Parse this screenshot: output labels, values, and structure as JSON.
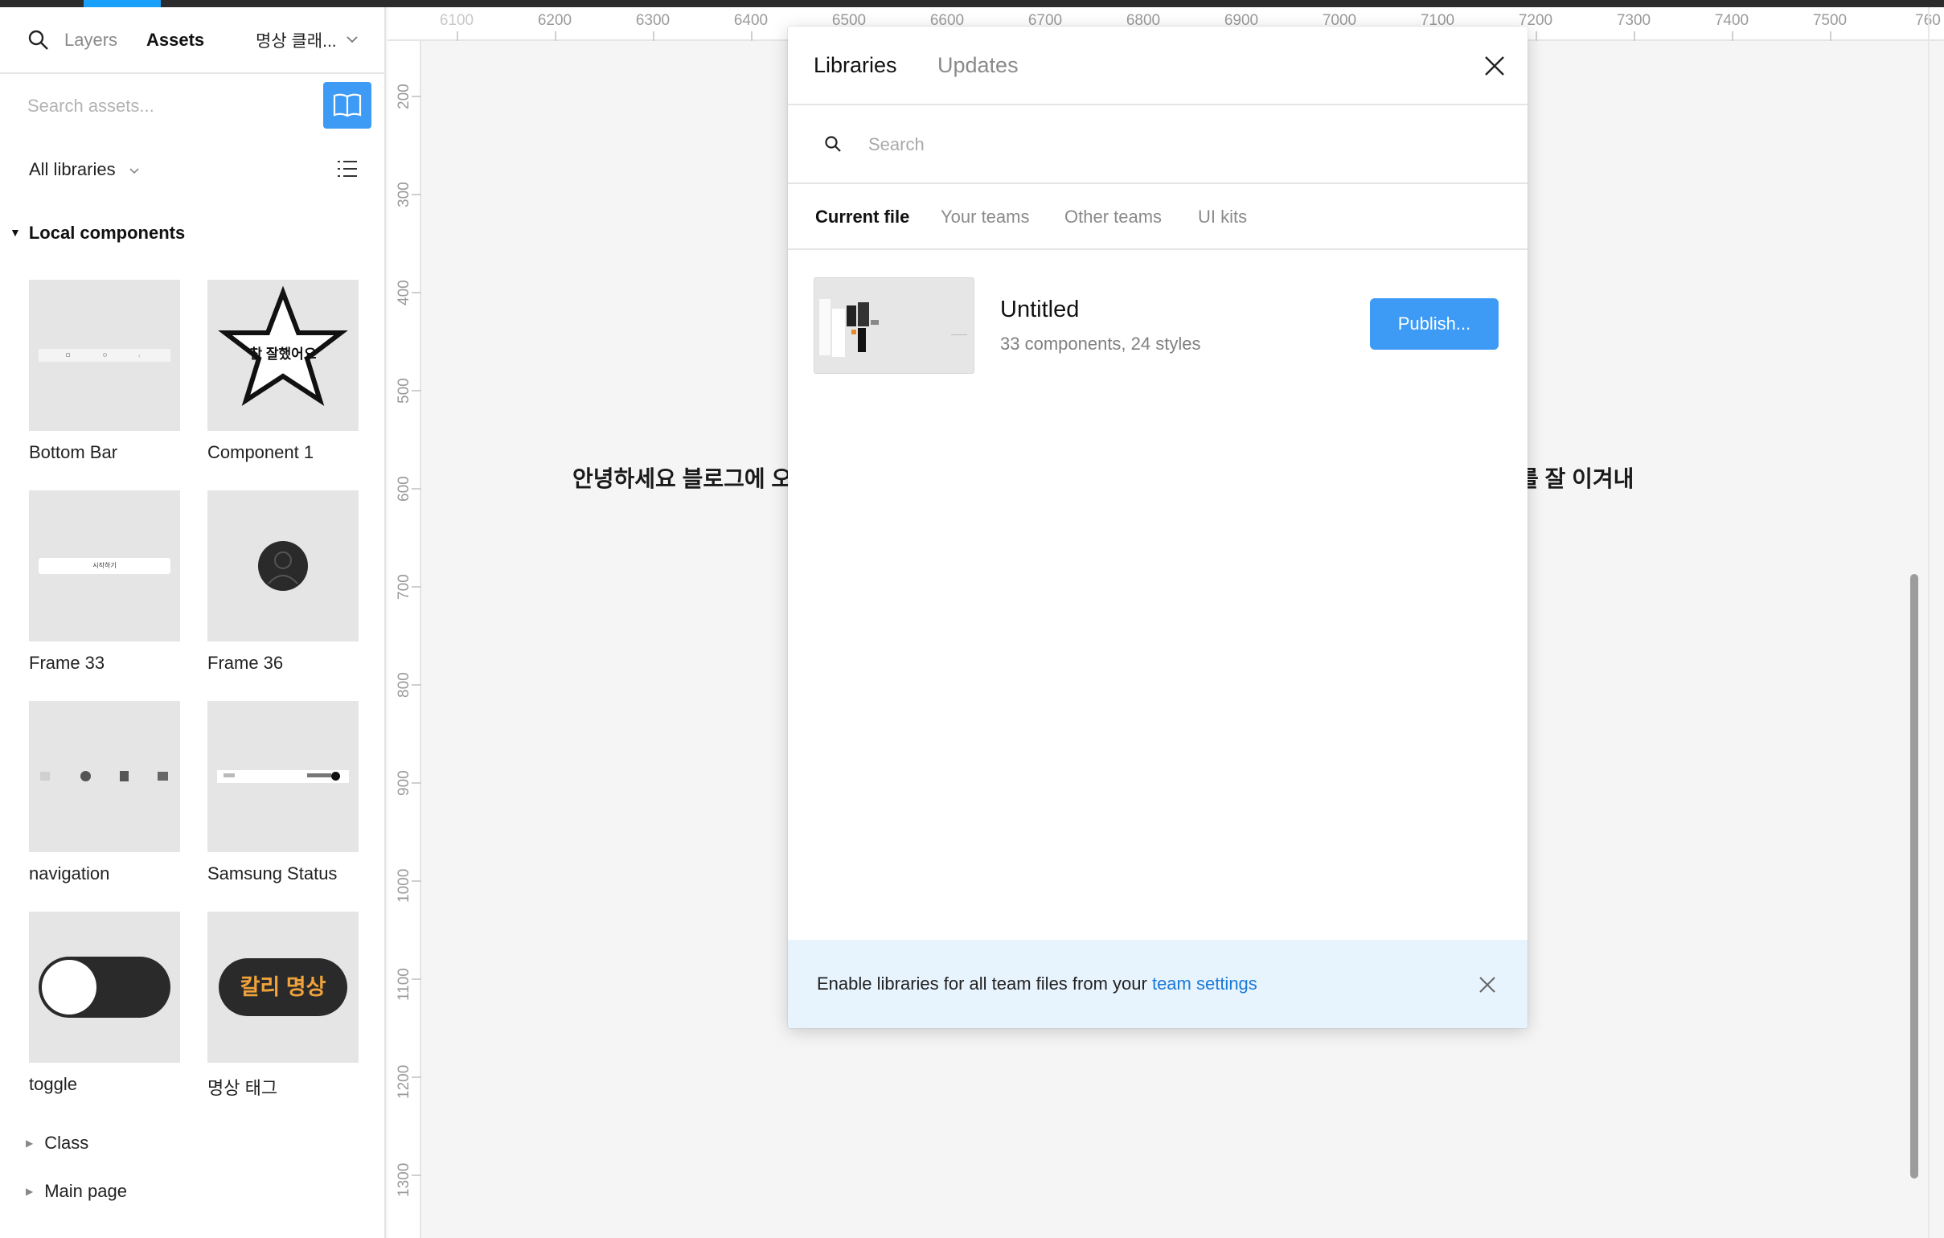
{
  "left_panel": {
    "tabs": {
      "layers": "Layers",
      "assets": "Assets"
    },
    "file_name": "명상 클래...",
    "search_placeholder": "Search assets...",
    "filter_label": "All libraries",
    "section_title": "Local components",
    "components": [
      {
        "label": "Bottom Bar"
      },
      {
        "label": "Component 1",
        "thumb_text": "참 잘했어요"
      },
      {
        "label": "Frame 33",
        "thumb_text": "시작하기"
      },
      {
        "label": "Frame 36"
      },
      {
        "label": "navigation"
      },
      {
        "label": "Samsung Status"
      },
      {
        "label": "toggle"
      },
      {
        "label": "명상 태그",
        "thumb_text": "칼리 명상"
      }
    ],
    "groups": [
      {
        "label": "Class"
      },
      {
        "label": "Main page"
      }
    ]
  },
  "ruler": {
    "top": [
      "6100",
      "6200",
      "6300",
      "6400",
      "6500",
      "6600",
      "6700",
      "6800",
      "6900",
      "7000",
      "7100",
      "7200",
      "7300",
      "7400",
      "7500",
      "760"
    ],
    "left": [
      "200",
      "300",
      "400",
      "500",
      "600",
      "700",
      "800",
      "900",
      "1000",
      "1100",
      "1200",
      "1300"
    ]
  },
  "canvas": {
    "text_left": "안녕하세요 블로그에 오",
    "text_right": "를 잘 이겨내"
  },
  "modal": {
    "tabs": {
      "libraries": "Libraries",
      "updates": "Updates"
    },
    "search_placeholder": "Search",
    "subtabs": [
      "Current file",
      "Your teams",
      "Other teams",
      "UI kits"
    ],
    "library": {
      "name": "Untitled",
      "meta": "33 components, 24 styles",
      "publish_label": "Publish..."
    },
    "footer": {
      "text": "Enable libraries for all team files from your",
      "link": "team settings"
    }
  },
  "colors": {
    "accent": "#3d9bf5",
    "footer_bg": "#e7f3fd",
    "link": "#1b7ad8"
  }
}
